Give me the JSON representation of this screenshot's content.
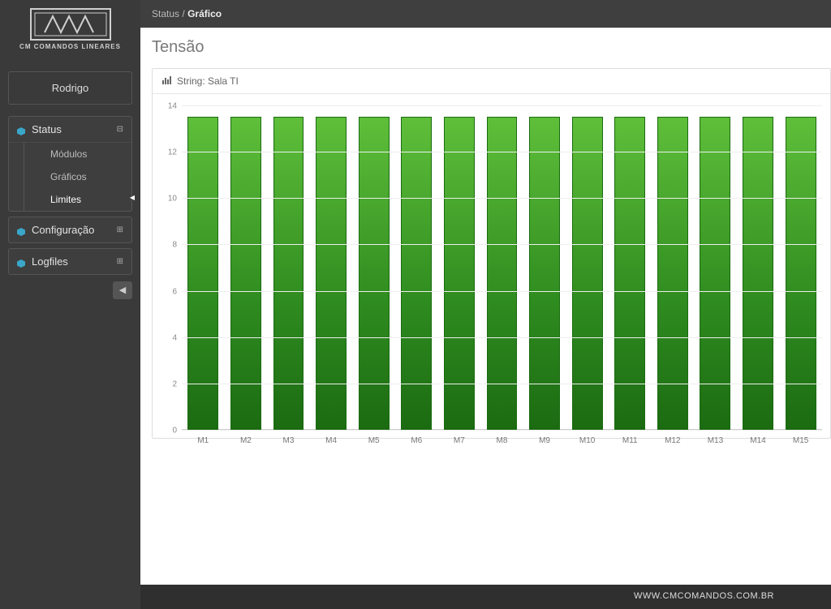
{
  "brand": "CM COMANDOS LINEARES",
  "user": "Rodrigo",
  "nav": {
    "status": {
      "label": "Status",
      "toggle": "⊟",
      "items": [
        "Módulos",
        "Gráficos",
        "Limites"
      ],
      "activeIndex": 2
    },
    "config": {
      "label": "Configuração",
      "toggle": "⊞"
    },
    "logs": {
      "label": "Logfiles",
      "toggle": "⊞"
    }
  },
  "breadcrumb": {
    "parent": "Status",
    "sep": "/",
    "current": "Gráfico"
  },
  "page_title": "Tensão",
  "panel_title": "String: Sala TI",
  "chart_data": {
    "type": "bar",
    "title": "Tensão",
    "xlabel": "",
    "ylabel": "",
    "ylim": [
      0,
      14
    ],
    "yticks": [
      0,
      2,
      4,
      6,
      8,
      10,
      12,
      14
    ],
    "categories": [
      "M1",
      "M2",
      "M3",
      "M4",
      "M5",
      "M6",
      "M7",
      "M8",
      "M9",
      "M10",
      "M11",
      "M12",
      "M13",
      "M14",
      "M15"
    ],
    "values": [
      13.5,
      13.5,
      13.5,
      13.5,
      13.5,
      13.5,
      13.5,
      13.5,
      13.5,
      13.5,
      13.5,
      13.5,
      13.5,
      13.5,
      13.5
    ]
  },
  "footer": "WWW.CMCOMANDOS.COM.BR"
}
